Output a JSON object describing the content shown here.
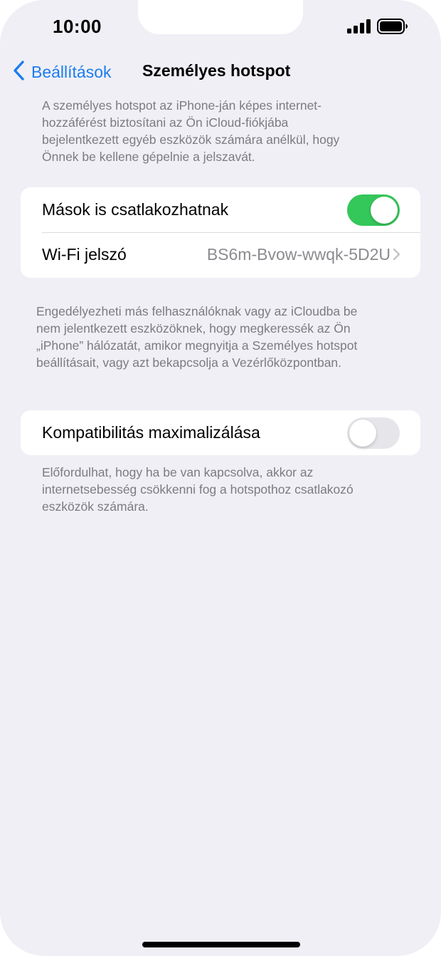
{
  "status_bar": {
    "time": "10:00",
    "signal_icon": "signal-bars-icon",
    "battery_icon": "battery-full-icon"
  },
  "nav": {
    "back_label": "Beállítások",
    "back_icon": "chevron-left-icon",
    "title": "Személyes hotspot"
  },
  "intro_text": [
    "A személyes hotspot az iPhone-ján képes internet-",
    "hozzáférést biztosítani az Ön iCloud-fiókjába",
    "bejelentkezett egyéb eszközök számára anélkül, hogy",
    "Önnek be kellene gépelnie a jelszavát."
  ],
  "group1": {
    "allow_others": {
      "label": "Mások is csatlakozhatnak",
      "toggle_on": true
    },
    "wifi_password": {
      "label": "Wi-Fi jelszó",
      "value": "BS6m-Bvow-wwqk-5D2U",
      "icon": "chevron-right-icon"
    }
  },
  "group1_footer": [
    "Engedélyezheti más felhasználóknak vagy az iCloudba be",
    "nem jelentkezett eszközöknek, hogy megkeressék az Ön",
    "„iPhone” hálózatát, amikor megnyitja a Személyes hotspot",
    "beállításait, vagy azt bekapcsolja a Vezérlőközpontban."
  ],
  "group2": {
    "maximize_compat": {
      "label": "Kompatibilitás maximalizálása",
      "toggle_on": false
    }
  },
  "group2_footer": [
    "Előfordulhat, hogy ha be van kapcsolva, akkor az",
    "internetsebesség csökkenni fog a hotspothoz csatlakozó",
    "eszközök számára."
  ],
  "colors": {
    "accent": "#1a7df0",
    "toggle_on": "#34c759",
    "background": "#f0eff5"
  }
}
